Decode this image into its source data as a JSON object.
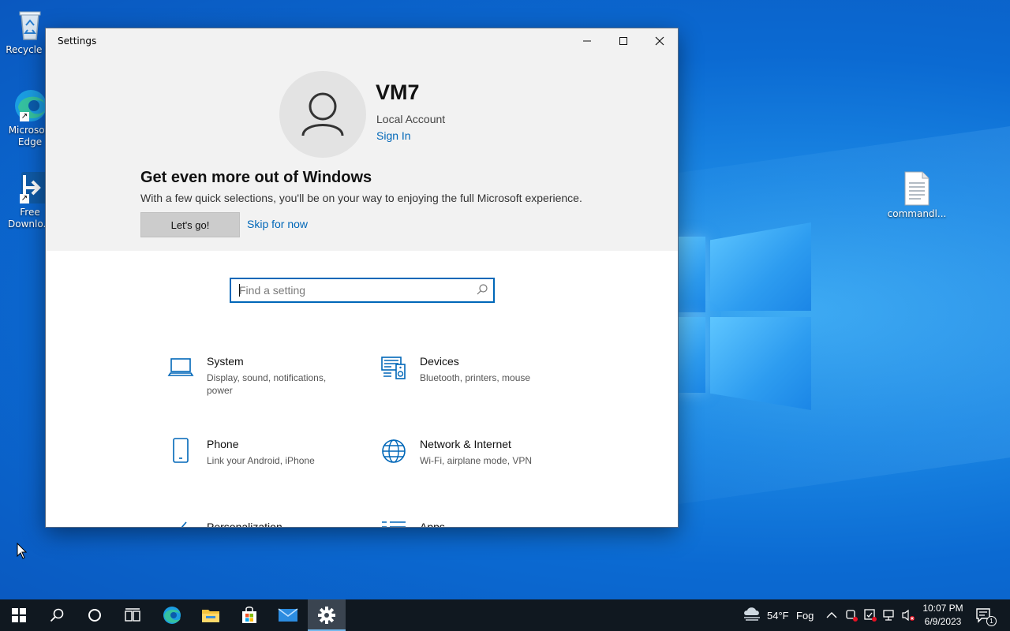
{
  "desktop": {
    "icons": [
      {
        "label": "Recycle Bi",
        "icon": "recycle-bin-icon"
      },
      {
        "label": "Microsoft\nEdge",
        "icon": "edge-icon"
      },
      {
        "label": "Free\nDownlo...",
        "icon": "free-download-manager-icon"
      },
      {
        "label": "commandl...",
        "icon": "text-file-icon"
      }
    ]
  },
  "window": {
    "title": "Settings",
    "controls": {
      "minimize": "minimize-icon",
      "maximize": "maximize-icon",
      "close": "close-icon"
    }
  },
  "account": {
    "name": "VM7",
    "type": "Local Account",
    "sign_in": "Sign In"
  },
  "promo": {
    "title": "Get even more out of Windows",
    "text": "With a few quick selections, you'll be on your way to enjoying the full Microsoft experience.",
    "primary_button": "Let's go!",
    "secondary_link": "Skip for now"
  },
  "search": {
    "placeholder": "Find a setting",
    "value": ""
  },
  "categories": [
    {
      "name": "System",
      "description": "Display, sound, notifications, power",
      "icon": "laptop-icon"
    },
    {
      "name": "Devices",
      "description": "Bluetooth, printers, mouse",
      "icon": "devices-icon"
    },
    {
      "name": "Phone",
      "description": "Link your Android, iPhone",
      "icon": "phone-icon"
    },
    {
      "name": "Network & Internet",
      "description": "Wi-Fi, airplane mode, VPN",
      "icon": "globe-icon"
    },
    {
      "name": "Personalization",
      "description": "",
      "icon": "brush-icon"
    },
    {
      "name": "Apps",
      "description": "",
      "icon": "apps-list-icon"
    }
  ],
  "taskbar": {
    "pinned": [
      "start-icon",
      "search-icon",
      "cortana-icon",
      "task-view-icon",
      "edge-icon",
      "file-explorer-icon",
      "store-icon",
      "mail-icon",
      "settings-gear-icon"
    ],
    "active": "settings-gear-icon",
    "weather": {
      "temp": "54°F",
      "condition": "Fog"
    },
    "clock": {
      "time": "10:07 PM",
      "date": "6/9/2023"
    },
    "notifications_count": "1"
  },
  "colors": {
    "accent": "#0067b8",
    "desktop_blue": "#0b6ad2",
    "taskbar": "#101820"
  }
}
